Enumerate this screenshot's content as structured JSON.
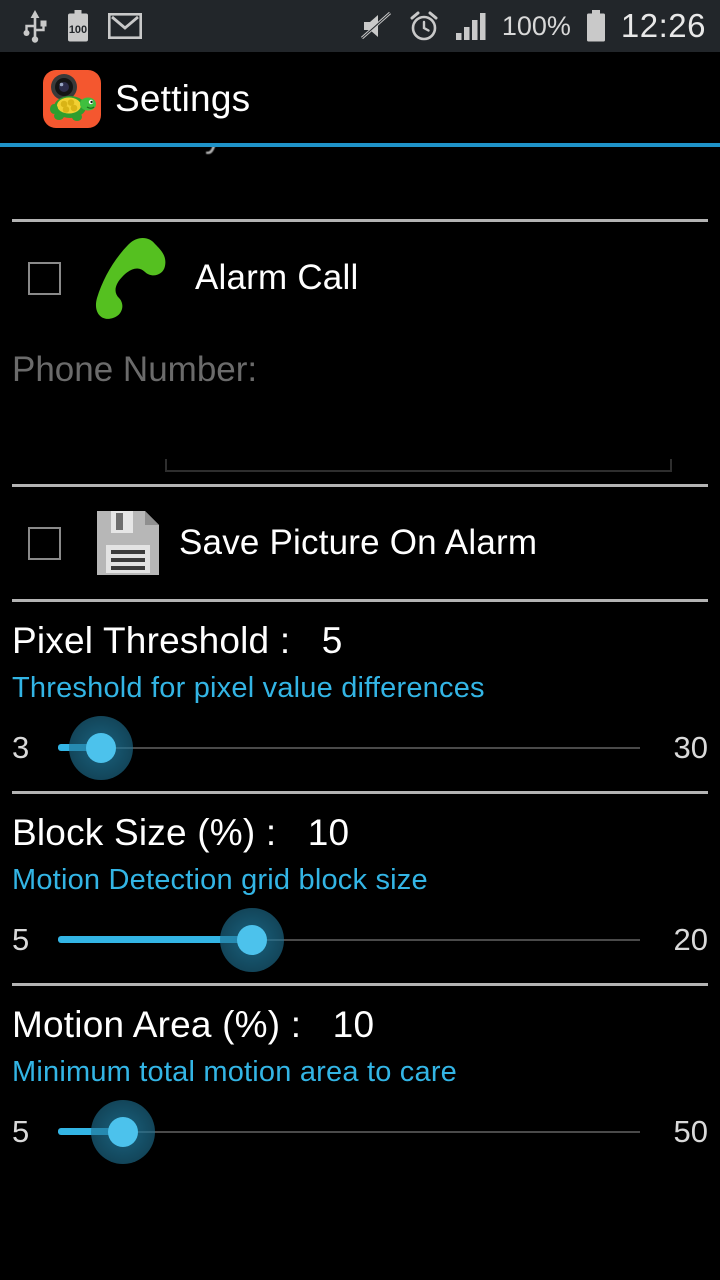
{
  "statusbar": {
    "icons_left": [
      "usb-icon",
      "battery-saver-icon",
      "gmail-icon"
    ],
    "battery_badge": "100",
    "icons_right": [
      "mute-icon",
      "alarm-clock-icon",
      "signal-bars-icon"
    ],
    "battery_percent": "100%",
    "clock": "12:26"
  },
  "actionbar": {
    "app_icon": "turtle-camera-icon",
    "title": "Settings",
    "accent_color": "#1f93c9"
  },
  "rows": {
    "alarm_call": {
      "label": "Alarm Call",
      "icon": "green-phone-icon",
      "checked": false
    },
    "phone_number": {
      "label": "Phone Number:",
      "value": "",
      "placeholder": ""
    },
    "save_picture": {
      "label": "Save Picture On Alarm",
      "icon": "floppy-disk-save-icon",
      "checked": false
    }
  },
  "sliders": [
    {
      "title": "Pixel Threshold :   5",
      "subtitle": "Threshold for pixel value differences",
      "value": 5,
      "min_label": "3",
      "max_label": "30",
      "min": 3,
      "max": 30
    },
    {
      "title": "Block Size (%) :   10",
      "subtitle": "Motion Detection grid block size",
      "value": 10,
      "min_label": "5",
      "max_label": "20",
      "min": 5,
      "max": 20
    },
    {
      "title": "Motion Area (%) :   10",
      "subtitle": "Minimum total motion area to care",
      "value": 10,
      "min_label": "5",
      "max_label": "50",
      "min": 5,
      "max": 50
    }
  ],
  "colors": {
    "accent_blue": "#33b5e5",
    "background": "#000000",
    "divider": "#b3b3b3",
    "subtitle_blue": "#33b5e5",
    "muted_text": "#6b6b6b",
    "statusbar_bg": "#22262a"
  }
}
